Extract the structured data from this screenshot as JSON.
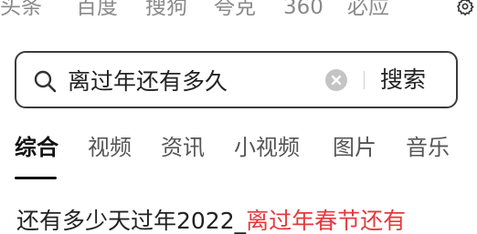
{
  "engines": [
    "头条",
    "百度",
    "搜狗",
    "夸克",
    "360",
    "必应"
  ],
  "settings_icon": "gear-icon",
  "search": {
    "query": "离过年还有多久",
    "button_label": "搜索",
    "icon": "search-icon",
    "clear_icon": "clear-icon"
  },
  "categories": [
    "综合",
    "视频",
    "资讯",
    "小视频",
    "图片",
    "音乐"
  ],
  "active_category": "综合",
  "result": {
    "title_plain": "还有多少天过年2022_",
    "title_highlight": "离过年春节还有"
  },
  "colors": {
    "highlight": "#e4393c",
    "muted": "#8a8a8a",
    "border": "#3b3b3b"
  }
}
